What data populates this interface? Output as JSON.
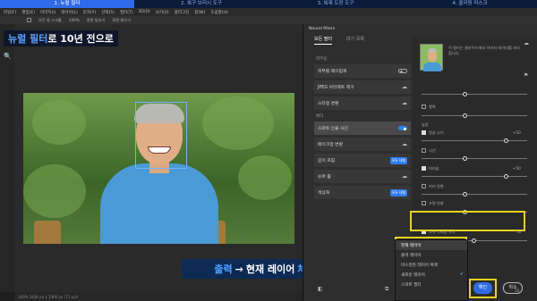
{
  "banner": {
    "steps": [
      "1. 뉴럴 필터",
      "2. 복구 브러시 도구",
      "3. 복제 도장 도구",
      "4. 클리핑 마스크"
    ],
    "active_index": 0
  },
  "menubar": {
    "items": [
      "파일(F)",
      "편집(E)",
      "이미지(I)",
      "레이어(L)",
      "문자(Y)",
      "선택(S)",
      "필터(T)",
      "3D(D)",
      "보기(V)",
      "플러그인",
      "창(W)",
      "도움말(H)"
    ]
  },
  "optbar": {
    "items": [
      "모든 창 스크롤",
      "100%",
      "화면 맞추기",
      "화면 채우기"
    ]
  },
  "headline": {
    "highlight": "뉴럴 필터",
    "rest": "로 10년 전으로"
  },
  "caption": {
    "part1": "출력",
    "arrow": "→",
    "part2": "현재 레이어",
    "part3": "체크"
  },
  "panel": {
    "title": "Neural filters",
    "tabs": [
      "모든 필터",
      "대기 목록"
    ],
    "sections": [
      {
        "label": "피부용",
        "items": [
          {
            "label": "피부를 매끄럽게",
            "ctrl": "toggle"
          },
          {
            "label": "JPEG 아티팩트 제거",
            "ctrl": "cloud"
          },
          {
            "label": "스타일 변환",
            "ctrl": "cloud"
          }
        ]
      },
      {
        "label": "베타",
        "items": [
          {
            "label": "스마트 인물 사진",
            "ctrl": "toggle-on"
          },
          {
            "label": "메이크업 변환",
            "ctrl": "cloud"
          },
          {
            "label": "깊이 흐림",
            "ctrl": "badge",
            "badge": "모두 대체"
          },
          {
            "label": "슈퍼 줌",
            "ctrl": "cloud"
          },
          {
            "label": "색상화",
            "ctrl": "badge",
            "badge": "모두 대체"
          }
        ]
      }
    ],
    "description": "이 필터는 클라우드에서 이미지 데이터를 처리합니다.",
    "sliders": [
      {
        "label": "행복",
        "type": "check",
        "checked": false,
        "value": ""
      },
      {
        "label": "놀람",
        "type": "check",
        "checked": false,
        "value": ""
      },
      {
        "label": "얼굴 나이",
        "type": "check",
        "checked": true,
        "value": "+50"
      },
      {
        "label": "시선",
        "type": "check",
        "checked": false,
        "value": ""
      },
      {
        "label": "머리숱",
        "type": "check",
        "checked": true,
        "value": "+50"
      },
      {
        "label": "머리 방향",
        "type": "check",
        "checked": false,
        "value": ""
      },
      {
        "label": "조명 방향",
        "type": "check",
        "checked": false,
        "value": ""
      }
    ],
    "checkbox_keep": {
      "label": "고유 디테일 유지",
      "value": "50"
    },
    "dropdown": {
      "selected_label": "현재 레이어",
      "options": [
        "출력 레이어",
        "마스킹된 레이어 복제",
        "새로운 레이어",
        "스마트 필터"
      ]
    },
    "ok_label": "확인",
    "cancel_label": "취소",
    "val_20": "20"
  },
  "status": {
    "text": "100% 1436 px x 1400 px (72 ppi)"
  },
  "colors": {
    "accent": "#2f6be8",
    "highlight_box": "#e8d21e"
  }
}
